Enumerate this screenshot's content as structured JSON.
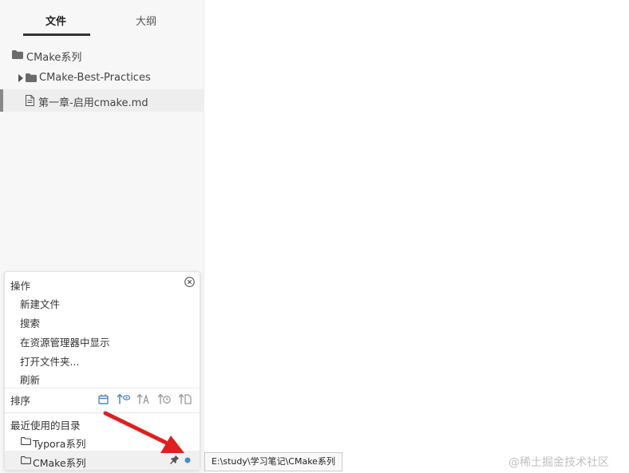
{
  "sidebar": {
    "tabs": [
      {
        "label": "文件",
        "active": true
      },
      {
        "label": "大纲",
        "active": false
      }
    ],
    "tree": [
      {
        "label": "CMake系列",
        "type": "folder"
      },
      {
        "label": "CMake-Best-Practices",
        "type": "folder",
        "collapsed": true
      },
      {
        "label": "第一章-启用cmake.md",
        "type": "file",
        "active": true
      }
    ]
  },
  "panel": {
    "actions_title": "操作",
    "actions": [
      "新建文件",
      "搜索",
      "在资源管理器中显示",
      "打开文件夹...",
      "刷新"
    ],
    "sort_label": "排序",
    "recent_title": "最近使用的目录",
    "recent": [
      {
        "label": "Typora系列"
      },
      {
        "label": "CMake系列",
        "active": true
      }
    ]
  },
  "tooltip": "E:\\study\\学习笔记\\CMake系列",
  "watermark": "@稀土掘金技术社区",
  "colors": {
    "accent": "#4a88c7",
    "arrow": "#e02020"
  }
}
